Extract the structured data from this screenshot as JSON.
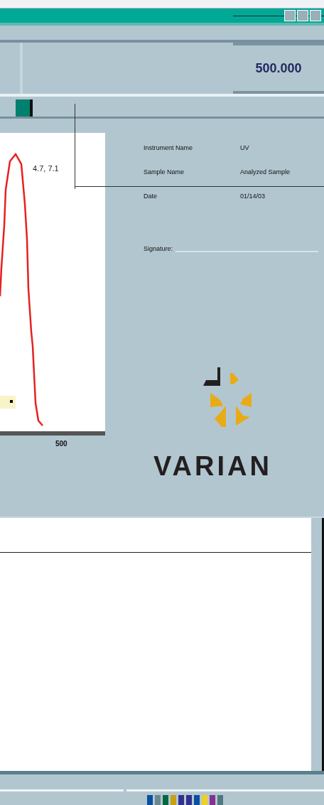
{
  "header": {
    "value": "500.000"
  },
  "chart": {
    "peak_label": "4.7, 7.1",
    "axis_label": "500"
  },
  "info": [
    {
      "label": "Instrument Name",
      "value": "UV"
    },
    {
      "label": "Sample Name",
      "value": "Analyzed Sample"
    },
    {
      "label": "Date",
      "value": "01/14/03"
    }
  ],
  "signature": {
    "label": "Signature:"
  },
  "logo": {
    "text": "VARIAN"
  }
}
